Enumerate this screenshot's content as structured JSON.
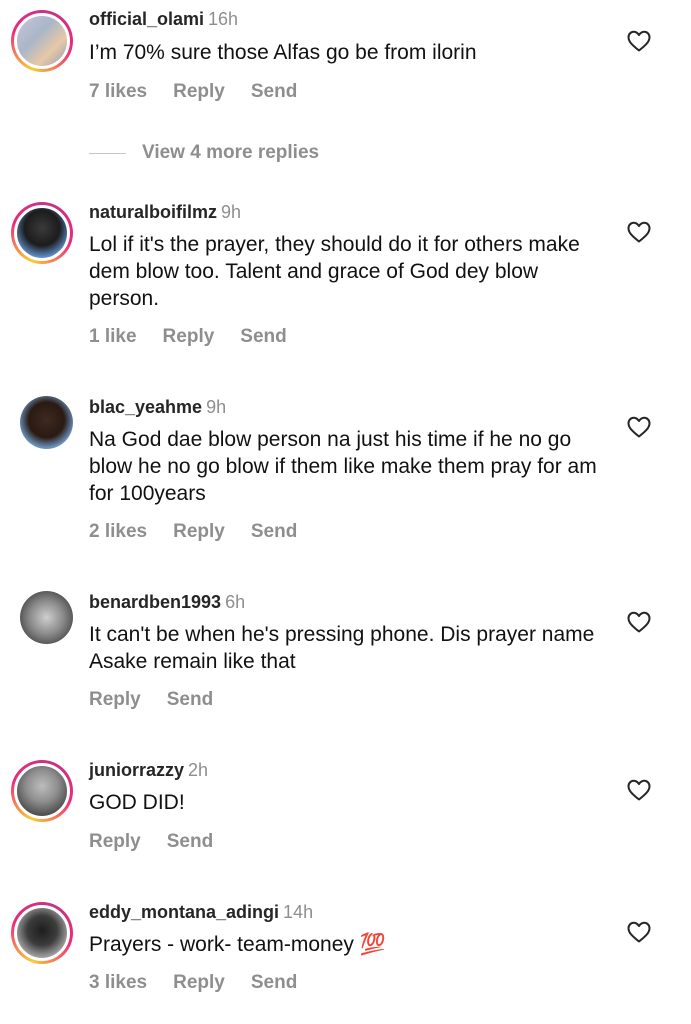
{
  "comments": [
    {
      "username": "official_olami",
      "time": "16h",
      "text": "I’m 70% sure those Alfas go be from ilorin",
      "likes": "7 likes",
      "reply": "Reply",
      "send": "Send",
      "view_replies": "View 4 more replies"
    },
    {
      "username": "naturalboifilmz",
      "time": "9h",
      "text": "Lol if it's the prayer, they should do it for others make dem blow too. Talent and grace of God dey blow person.",
      "likes": "1 like",
      "reply": "Reply",
      "send": "Send"
    },
    {
      "username": "blac_yeahme",
      "time": "9h",
      "text": "Na God dae blow person na just his time if he no go blow he no go blow if them like make them pray for am for 100years",
      "likes": "2 likes",
      "reply": "Reply",
      "send": "Send"
    },
    {
      "username": "benardben1993",
      "time": "6h",
      "text": "It can't be when he's pressing phone. Dis prayer name Asake remain like that",
      "reply": "Reply",
      "send": "Send"
    },
    {
      "username": "juniorrazzy",
      "time": "2h",
      "text": "GOD DID!",
      "reply": "Reply",
      "send": "Send"
    },
    {
      "username": "eddy_montana_adingi",
      "time": "14h",
      "text": "Prayers - work- team-money 💯",
      "likes": "3 likes",
      "reply": "Reply",
      "send": "Send"
    }
  ],
  "icons": {
    "like": "heart-outline-icon"
  },
  "colors": {
    "text": "#111111",
    "secondary": "#8e8e8e",
    "story_ring_start": "#f9ce34",
    "story_ring_end": "#ee2a7b"
  }
}
